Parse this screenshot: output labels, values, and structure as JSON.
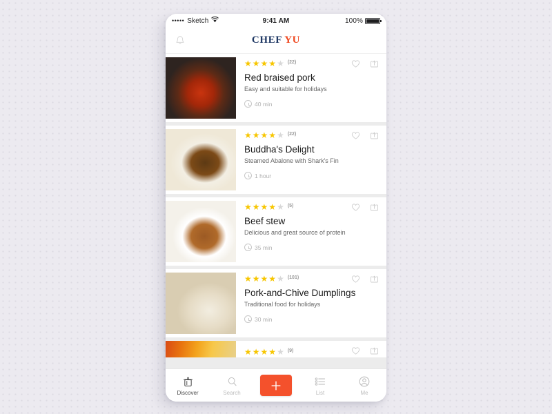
{
  "status_bar": {
    "signal_dots": "•••••",
    "carrier": "Sketch",
    "wifi_icon": "wifi-icon",
    "time": "9:41 AM",
    "battery_percent": "100%"
  },
  "app_bar": {
    "bell_icon": "bell-icon",
    "logo_part1": "CHEF",
    "logo_part2": "YU",
    "logo_color_1": "#1f3864",
    "logo_color_2": "#ef4a22"
  },
  "colors": {
    "accent": "#f4512c",
    "star_on": "#f7c600",
    "star_off": "#d8d8d8",
    "page_background": "#eceaf0"
  },
  "recipes": [
    {
      "title": "Red braised pork",
      "subtitle": "Easy and suitable for holidays",
      "rating": 4,
      "rating_max": 5,
      "rating_count": "(22)",
      "time": "40 min",
      "favorite_icon": "heart-icon",
      "share_icon": "share-icon",
      "image": "red-braised-pork-photo"
    },
    {
      "title": "Buddha's Delight",
      "subtitle": "Steamed Abalone with Shark's Fin",
      "rating": 4,
      "rating_max": 5,
      "rating_count": "(22)",
      "time": "1 hour",
      "favorite_icon": "heart-icon",
      "share_icon": "share-icon",
      "image": "buddhas-delight-photo"
    },
    {
      "title": "Beef stew",
      "subtitle": "Delicious and great source of protein",
      "rating": 4,
      "rating_max": 5,
      "rating_count": "(5)",
      "time": "35 min",
      "favorite_icon": "heart-icon",
      "share_icon": "share-icon",
      "image": "beef-stew-photo"
    },
    {
      "title": "Pork-and-Chive Dumplings",
      "subtitle": "Traditional food for holidays",
      "rating": 4,
      "rating_max": 5,
      "rating_count": "(101)",
      "time": "30 min",
      "favorite_icon": "heart-icon",
      "share_icon": "share-icon",
      "image": "pork-and-chive-dumplings-photo"
    },
    {
      "title": "",
      "subtitle": "",
      "rating": 4,
      "rating_max": 5,
      "rating_count": "(9)",
      "time": "",
      "favorite_icon": "heart-icon",
      "share_icon": "share-icon",
      "image": "next-recipe-photo"
    }
  ],
  "tab_bar": {
    "tabs": [
      {
        "label": "Discover",
        "icon": "cooking-pot-icon",
        "active": true
      },
      {
        "label": "Search",
        "icon": "search-icon",
        "active": false
      },
      {
        "label": "List",
        "icon": "list-icon",
        "active": false
      },
      {
        "label": "Me",
        "icon": "person-icon",
        "active": false
      }
    ],
    "add_button": {
      "label": "+",
      "icon": "plus-icon"
    }
  }
}
